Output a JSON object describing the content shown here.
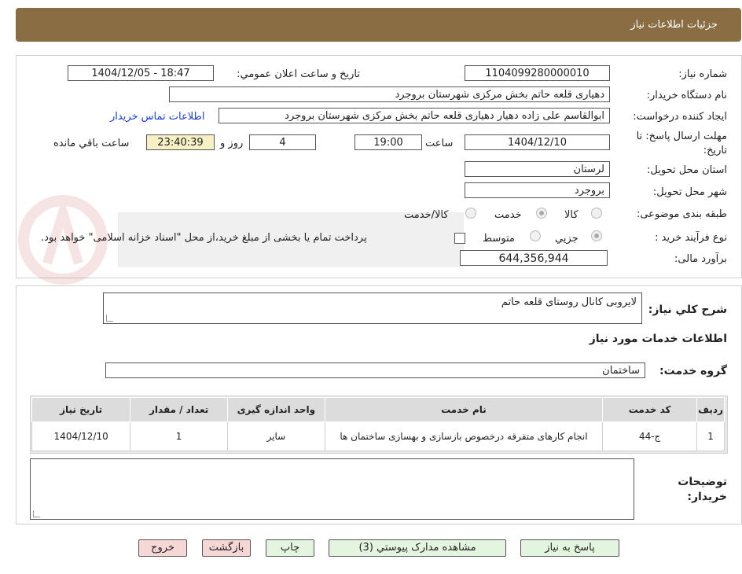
{
  "header": {
    "title": "جزئیات اطلاعات نیاز"
  },
  "form": {
    "need_number_label": "شماره نیاز:",
    "need_number": "1104099280000010",
    "announce_label": "تاریخ و ساعت اعلان عمومي:",
    "announce_value": "1404/12/05 - 18:47",
    "buyer_org_label": "نام دستگاه خریدار:",
    "buyer_org": "دهیاری قلعه حاتم بخش مرکزی شهرستان بروجرد",
    "creator_label": "ایجاد کننده درخواست:",
    "creator": "ابوالقاسم علی زاده دهیار دهیاری قلعه حاتم بخش مرکزی شهرستان بروجرد",
    "contact_link": "اطلاعات تماس خریدار",
    "deadline_label_1": "مهلت ارسال پاسخ: تا",
    "deadline_label_2": "تاریخ:",
    "deadline_date": "1404/12/10",
    "time_label": "ساعت",
    "deadline_time": "19:00",
    "days_value": "4",
    "days_label": "روز و",
    "remaining_time": "23:40:39",
    "remaining_label": "ساعت باقي مانده",
    "province_label": "استان محل تحویل:",
    "province": "لرستان",
    "city_label": "شهر محل تحویل:",
    "city": "بروجرد",
    "category_label": "طبقه بندی موضوعی:",
    "category_options": [
      "کالا",
      "خدمت",
      "کالا/خدمت"
    ],
    "category_selected": 1,
    "process_label": "نوع فرآیند خرید :",
    "process_options": [
      "جزیي",
      "متوسط"
    ],
    "process_selected": 0,
    "process_note": "پرداخت تمام یا بخشی از مبلغ خرید،از محل \"اسناد خزانه اسلامی\" خواهد بود.",
    "budget_label": "برآورد مالی:",
    "budget": "644,356,944"
  },
  "description": {
    "label": "شرح کلي نیاز:",
    "value": "لایروبی کانال روستای قلعه حاتم"
  },
  "services": {
    "section_title": "اطلاعات خدمات مورد نیاز",
    "group_label": "گروه خدمت:",
    "group_value": "ساختمان",
    "columns": [
      "ردیف",
      "کد خدمت",
      "نام خدمت",
      "واحد اندازه گیری",
      "تعداد / مقدار",
      "تاریخ نیاز"
    ],
    "rows": [
      [
        "1",
        "ج-44",
        "انجام کارهای متفرقه درخصوص بازسازی و بهسازی ساختمان ها",
        "سایر",
        "1",
        "1404/12/10"
      ]
    ]
  },
  "buyer_notes": {
    "label_1": "توضیحات",
    "label_2": "خریدار:",
    "value": ""
  },
  "buttons": {
    "reply": "پاسخ به نیاز",
    "attachments": "مشاهده مدارک پیوستي (3)",
    "print": "چاپ",
    "back": "بازگشت",
    "exit": "خروج"
  },
  "colors": {
    "header_bg": "#8b6d43",
    "highlight_bg": "#f6f0c4",
    "button_green": "#e4f5df",
    "button_pink": "#f7d6d6",
    "link": "#1a3ed6"
  }
}
